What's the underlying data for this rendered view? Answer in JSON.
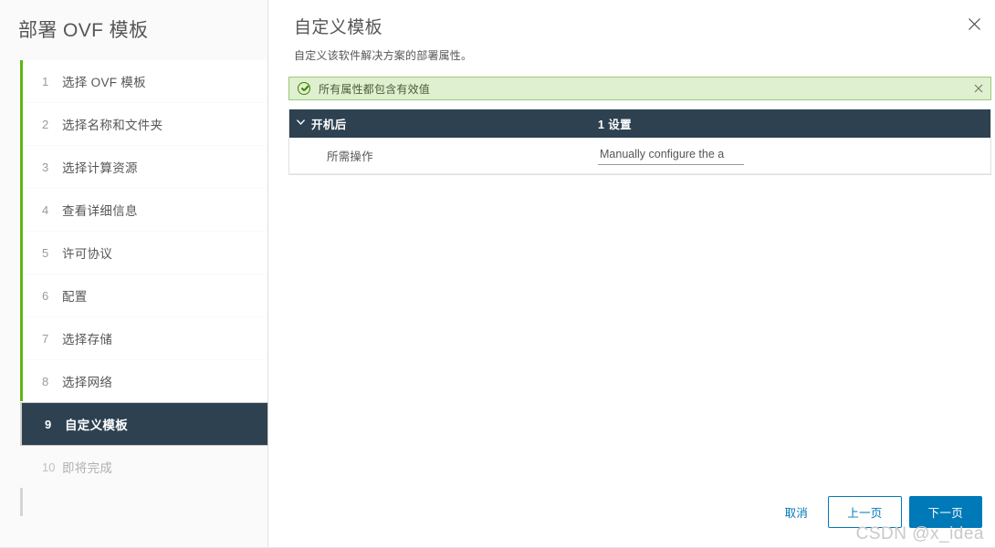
{
  "window": {
    "title": "部署 OVF 模板",
    "close_label": "✕",
    "close_icon": "close-icon"
  },
  "sidebar": {
    "items": [
      {
        "num": "1",
        "label": "选择 OVF 模板",
        "state": "done"
      },
      {
        "num": "2",
        "label": "选择名称和文件夹",
        "state": "done"
      },
      {
        "num": "3",
        "label": "选择计算资源",
        "state": "done"
      },
      {
        "num": "4",
        "label": "查看详细信息",
        "state": "done"
      },
      {
        "num": "5",
        "label": "许可协议",
        "state": "done"
      },
      {
        "num": "6",
        "label": "配置",
        "state": "done"
      },
      {
        "num": "7",
        "label": "选择存储",
        "state": "done"
      },
      {
        "num": "8",
        "label": "选择网络",
        "state": "done"
      },
      {
        "num": "9",
        "label": "自定义模板",
        "state": "active"
      },
      {
        "num": "10",
        "label": "即将完成",
        "state": "pending"
      }
    ]
  },
  "main": {
    "title": "自定义模板",
    "subtitle": "自定义该软件解决方案的部署属性。",
    "banner": {
      "text": "所有属性都包含有效值",
      "icon": "check-circle-icon",
      "close_label": "✕",
      "close_icon": "close-icon",
      "bg_color": "#dff0d0",
      "border_color": "#9bc97a",
      "accent_color": "#3f7e00"
    },
    "table": {
      "group": {
        "caret_icon": "chevron-down-icon",
        "name": "开机后",
        "count": "1 设置",
        "header_bg": "#2d4150"
      },
      "rows": [
        {
          "name": "所需操作",
          "value": "Manually configure the a",
          "placeholder": ""
        }
      ]
    }
  },
  "footer": {
    "cancel_label": "取消",
    "back_label": "上一页",
    "next_label": "下一页",
    "accent_color": "#0079b8"
  },
  "watermark": {
    "text": "CSDN @x_idea"
  },
  "theme": {
    "progress_green": "#60b515",
    "active_navy": "#2d4150",
    "text_gray": "#565656"
  }
}
